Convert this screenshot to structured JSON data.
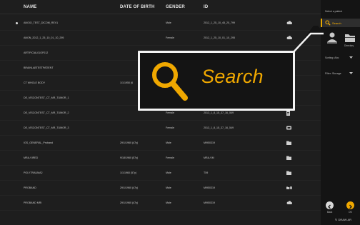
{
  "table": {
    "columns": {
      "name": "NAME",
      "dob": "DATE OF BIRTH",
      "gender": "GENDER",
      "id": "ID"
    },
    "rows": [
      {
        "name": "ANGIO_TEST_DICOM_REV1",
        "dob": "",
        "gender": "Male",
        "id": "2012_1_25_10_45_20_799",
        "icon": "cloud-icon",
        "selected": true
      },
      {
        "name": "ANON_2012_1_25_10_01_10_295",
        "dob": "",
        "gender": "Female",
        "id": "2012_1_25_10_01_10_295",
        "icon": "cloud-icon",
        "selected": false
      },
      {
        "name": "ARTIFICIAL01OF012",
        "dob": "",
        "gender": "",
        "id": "",
        "icon": "",
        "selected": false
      },
      {
        "name": "BRAINLABTESTPATIENT",
        "dob": "",
        "gender": "",
        "id": "",
        "icon": "",
        "selected": false
      },
      {
        "name": "CT WHOLE BODY",
        "dob": "1/1/1950 (6",
        "gender": "",
        "id": "",
        "icon": "",
        "selected": false
      },
      {
        "name": "DE_VISCONTEST_CT_MR_TUMOR_1",
        "dob": "",
        "gender": "",
        "id": "",
        "icon": "",
        "selected": false
      },
      {
        "name": "DE_VISCONTEST_CT_MR_TUMOR_2",
        "dob": "",
        "gender": "Female",
        "id": "2013_1_8_15_37_16_549",
        "icon": "document-icon",
        "selected": false
      },
      {
        "name": "DE_VISCONTEST_CT_MR_TUMOR_3",
        "dob": "",
        "gender": "Female",
        "id": "2013_1_8_15_37_16_549",
        "icon": "monitor-icon",
        "selected": false
      },
      {
        "name": "IGS_GENERAL_Proband",
        "dob": "29/1/1960 (47y)",
        "gender": "Male",
        "id": "MI950319",
        "icon": "folder-icon",
        "selected": false
      },
      {
        "name": "MRA-VIRED",
        "dob": "9/18/1960 (57y)",
        "gender": "Female",
        "id": "MRA-VM",
        "icon": "folder-icon",
        "selected": false
      },
      {
        "name": "POLYTRAUMA2",
        "dob": "1/1/1960 (57y)",
        "gender": "Male",
        "id": "T59",
        "icon": "folder-icon",
        "selected": false
      },
      {
        "name": "PROBAND",
        "dob": "29/1/1960 (47y)",
        "gender": "Male",
        "id": "MI950319",
        "icon": "folder-doc-icon",
        "selected": false
      },
      {
        "name": "PROBAND MRI",
        "dob": "29/1/1960 (47y)",
        "gender": "Male",
        "id": "MI950319",
        "icon": "cloud-icon",
        "selected": false
      }
    ]
  },
  "sidebar": {
    "title": "Select a patient",
    "search_label": "Search",
    "card1_label": "",
    "card2_label": "Directory",
    "dropdown1": "Sorting: Abc",
    "dropdown2": "Filter: Storage",
    "back_label": "Back",
    "next_label": "OK",
    "draw_all": "DRAW AR"
  },
  "callout": {
    "label": "Search",
    "icon": "search-icon"
  },
  "colors": {
    "accent": "#f0a800",
    "background": "#1e1e1e",
    "sidebar": "#141414",
    "callout_border": "#f4f4f4"
  }
}
